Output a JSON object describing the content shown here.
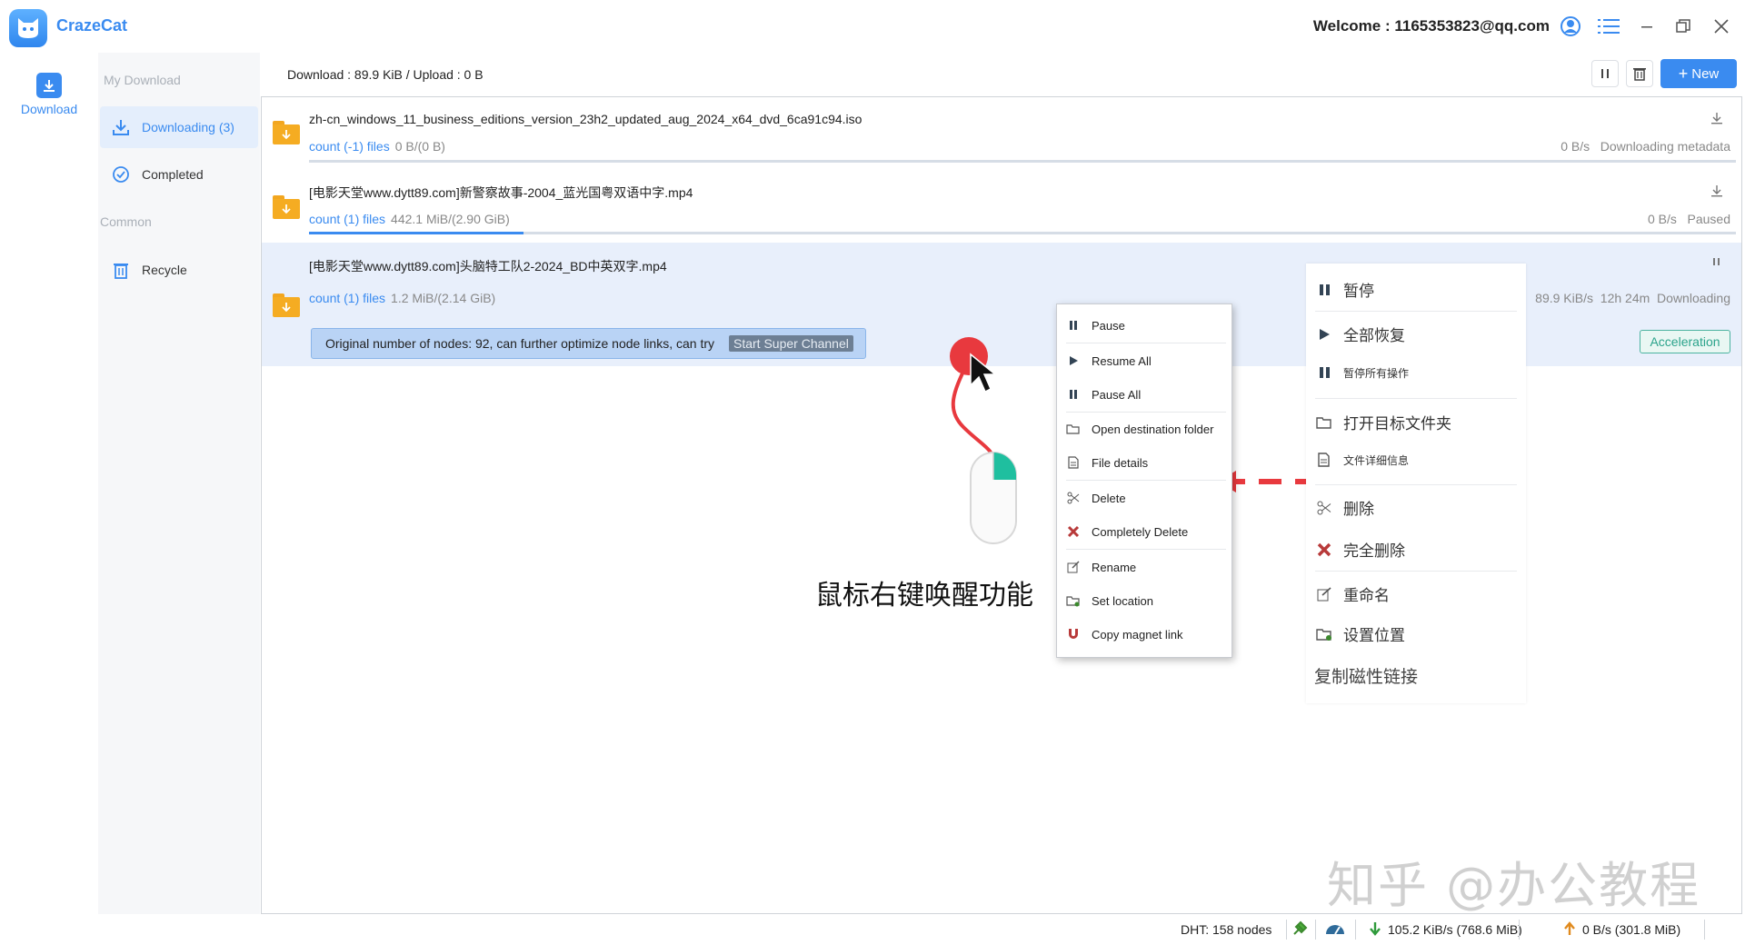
{
  "app": {
    "name": "CrazeCat",
    "welcome": "Welcome : 1165353823@qq.com"
  },
  "nav": {
    "download_label": "Download"
  },
  "sidebar": {
    "my_download_header": "My Download",
    "downloading_label": "Downloading (3)",
    "completed_label": "Completed",
    "common_header": "Common",
    "recycle_label": "Recycle"
  },
  "toolbar": {
    "stats": "Download : 89.9 KiB / Upload : 0 B",
    "new_label": "New"
  },
  "tasks": [
    {
      "name": "zh-cn_windows_11_business_editions_version_23h2_updated_aug_2024_x64_dvd_6ca91c94.iso",
      "count": "count (-1) files",
      "size": "0 B/(0 B)",
      "speed": "0 B/s",
      "status": "Downloading metadata",
      "progress": 0
    },
    {
      "name": "[电影天堂www.dytt89.com]新警察故事-2004_蓝光国粤双语中字.mp4",
      "count": "count (1) files",
      "size": "442.1 MiB/(2.90 GiB)",
      "speed": "0 B/s",
      "status": "Paused",
      "progress": 0.15
    },
    {
      "name": "[电影天堂www.dytt89.com]头脑特工队2-2024_BD中英双字.mp4",
      "count": "count (1) files",
      "size": "1.2 MiB/(2.14 GiB)",
      "speed": "89.9 KiB/s",
      "eta": "12h 24m",
      "status": "Downloading",
      "banner_text": "Original number of nodes: 92, can further optimize node links, can try",
      "banner_button": "Start Super Channel",
      "accel_label": "Acceleration"
    }
  ],
  "context_menu": {
    "pause": "Pause",
    "resume_all": "Resume All",
    "pause_all": "Pause All",
    "open_folder": "Open destination folder",
    "file_details": "File details",
    "delete": "Delete",
    "completely_delete": "Completely Delete",
    "rename": "Rename",
    "set_location": "Set location",
    "copy_magnet": "Copy magnet link"
  },
  "cn_menu": {
    "pause": "暂停",
    "resume_all": "全部恢复",
    "pause_all": "暂停所有操作",
    "open_folder": "打开目标文件夹",
    "file_details": "文件详细信息",
    "delete": "删除",
    "completely_delete": "完全删除",
    "rename": "重命名",
    "set_location": "设置位置",
    "copy_magnet": "复制磁性链接"
  },
  "annotation": {
    "caption": "鼠标右键唤醒功能",
    "watermark": "知乎 @办公教程"
  },
  "statusbar": {
    "dht": "DHT: 158 nodes",
    "down": "105.2 KiB/s (768.6 MiB)",
    "up": "0 B/s (301.8 MiB)"
  },
  "colors": {
    "accent": "#3a8bf0",
    "folder": "#f5ac22",
    "delete_red": "#b83a3a",
    "arrow_red": "#e83a3f"
  }
}
